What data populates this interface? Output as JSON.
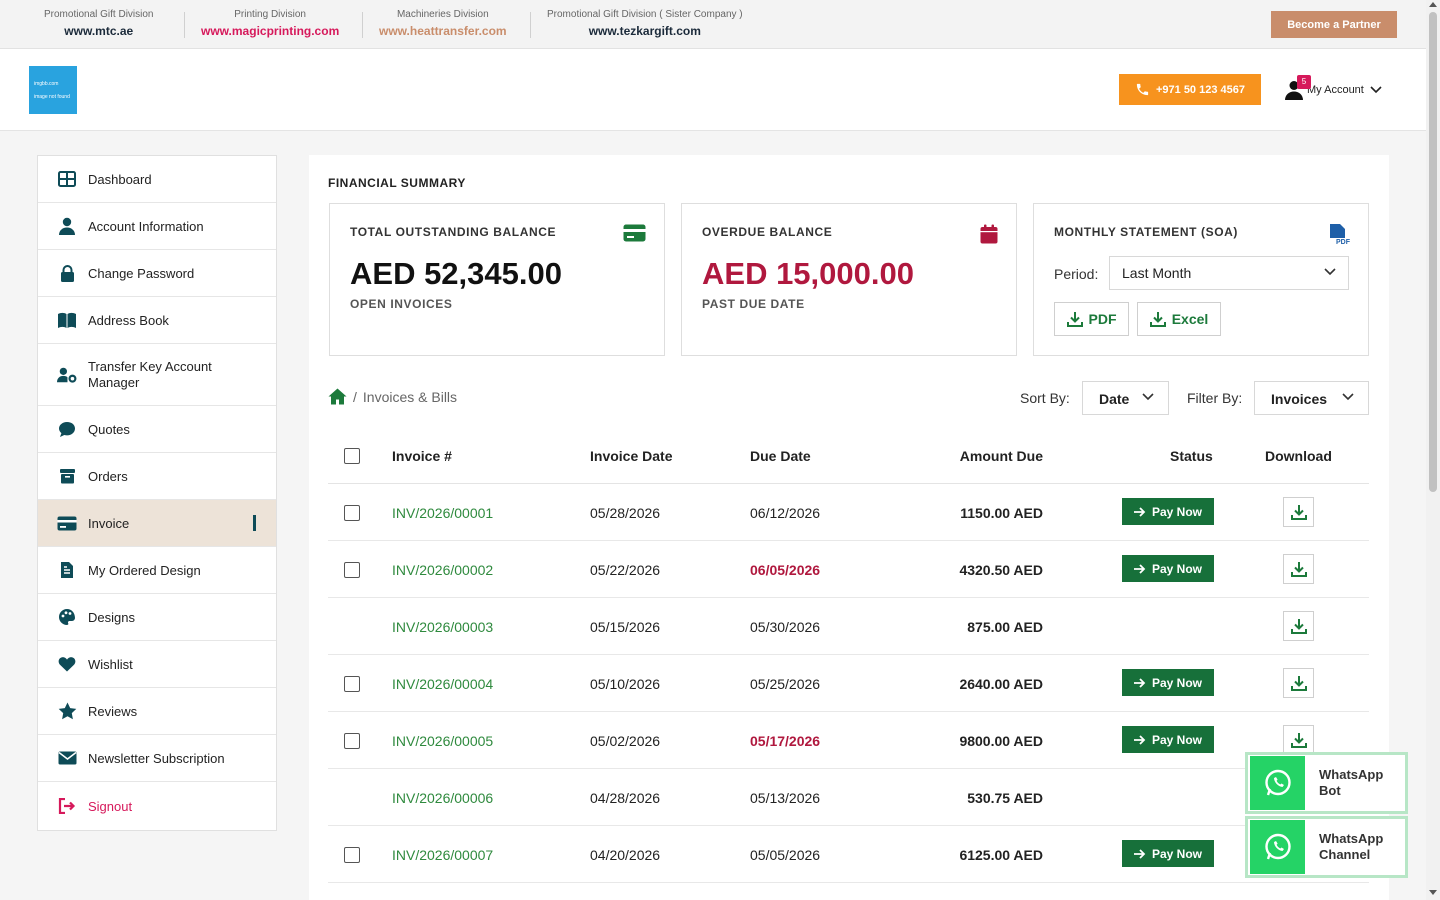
{
  "topbar": {
    "divisions": [
      {
        "label": "Promotional Gift Division",
        "url": "www.mtc.ae",
        "color": "#1b2a3a"
      },
      {
        "label": "Printing Division",
        "url": "www.magicprinting.com",
        "color": "#d6195b"
      },
      {
        "label": "Machineries Division",
        "url": "www.heattransfer.com",
        "color": "#c98d6b"
      },
      {
        "label": "Promotional Gift Division ( Sister Company )",
        "url": "www.tezkargift.com",
        "color": "#1b2a3a"
      }
    ],
    "partner_label": "Become a Partner"
  },
  "header": {
    "logo_line1": "imgbb.com",
    "logo_line2": "image not found",
    "phone": "+971 50 123 4567",
    "account_label": "My Account",
    "account_badge": "5"
  },
  "sidebar": {
    "items": [
      {
        "label": "Dashboard",
        "icon": "dashboard-icon"
      },
      {
        "label": "Account Information",
        "icon": "user-icon"
      },
      {
        "label": "Change Password",
        "icon": "lock-icon"
      },
      {
        "label": "Address Book",
        "icon": "book-icon"
      },
      {
        "label": "Transfer Key Account Manager",
        "icon": "user-gear-icon"
      },
      {
        "label": "Quotes",
        "icon": "chat-icon"
      },
      {
        "label": "Orders",
        "icon": "box-icon"
      },
      {
        "label": "Invoice",
        "icon": "card-icon"
      },
      {
        "label": "My Ordered Design",
        "icon": "document-icon"
      },
      {
        "label": "Designs",
        "icon": "palette-icon"
      },
      {
        "label": "Wishlist",
        "icon": "heart-icon"
      },
      {
        "label": "Reviews",
        "icon": "star-icon"
      },
      {
        "label": "Newsletter Subscription",
        "icon": "envelope-icon"
      },
      {
        "label": "Signout",
        "icon": "signout-icon"
      }
    ]
  },
  "summary": {
    "title": "FINANCIAL SUMMARY",
    "outstanding": {
      "title": "TOTAL OUTSTANDING BALANCE",
      "amount": "AED 52,345.00",
      "sub": "OPEN INVOICES"
    },
    "overdue": {
      "title": "OVERDUE BALANCE",
      "amount": "AED 15,000.00",
      "sub": "PAST DUE DATE"
    },
    "statement": {
      "title": "MONTHLY STATEMENT (SOA)",
      "period_label": "Period:",
      "period_value": "Last Month",
      "pdf_label": "PDF",
      "excel_label": "Excel"
    }
  },
  "toolbar": {
    "breadcrumb_sep": "/",
    "breadcrumb": "Invoices & Bills",
    "sort_label": "Sort By:",
    "sort_value": "Date",
    "filter_label": "Filter By:",
    "filter_value": "Invoices"
  },
  "table": {
    "headers": {
      "invoice": "Invoice #",
      "date": "Invoice Date",
      "due": "Due Date",
      "amount": "Amount Due",
      "status": "Status",
      "download": "Download"
    },
    "pay_label": "Pay Now",
    "rows": [
      {
        "invoice": "INV/2026/00001",
        "date": "05/28/2026",
        "due": "06/12/2026",
        "amount": "1150.00 AED",
        "overdue": false,
        "payable": true
      },
      {
        "invoice": "INV/2026/00002",
        "date": "05/22/2026",
        "due": "06/05/2026",
        "amount": "4320.50 AED",
        "overdue": true,
        "payable": true
      },
      {
        "invoice": "INV/2026/00003",
        "date": "05/15/2026",
        "due": "05/30/2026",
        "amount": "875.00 AED",
        "overdue": false,
        "payable": false
      },
      {
        "invoice": "INV/2026/00004",
        "date": "05/10/2026",
        "due": "05/25/2026",
        "amount": "2640.00 AED",
        "overdue": false,
        "payable": true
      },
      {
        "invoice": "INV/2026/00005",
        "date": "05/02/2026",
        "due": "05/17/2026",
        "amount": "9800.00 AED",
        "overdue": true,
        "payable": true
      },
      {
        "invoice": "INV/2026/00006",
        "date": "04/28/2026",
        "due": "05/13/2026",
        "amount": "530.75 AED",
        "overdue": false,
        "payable": false
      },
      {
        "invoice": "INV/2026/00007",
        "date": "04/20/2026",
        "due": "05/05/2026",
        "amount": "6125.00 AED",
        "overdue": false,
        "payable": true
      }
    ]
  },
  "whatsapp": {
    "bot": {
      "line1": "WhatsApp",
      "line2": "Bot"
    },
    "channel": {
      "line1": "WhatsApp",
      "line2": "Channel"
    }
  },
  "colors": {
    "accent_green": "#17703a",
    "brand_pink": "#d6195b",
    "overdue_red": "#b0183e",
    "sidebar_active": "#ede3d8",
    "icon_teal": "#0e4b57"
  }
}
